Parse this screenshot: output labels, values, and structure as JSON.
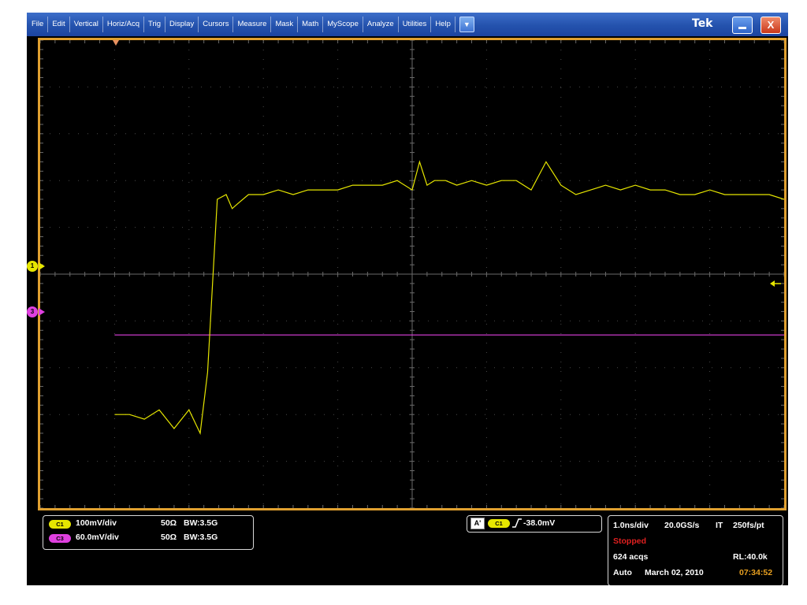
{
  "menu": {
    "items": [
      "File",
      "Edit",
      "Vertical",
      "Horiz/Acq",
      "Trig",
      "Display",
      "Cursors",
      "Measure",
      "Mask",
      "Math",
      "MyScope",
      "Analyze",
      "Utilities",
      "Help"
    ],
    "more_icon": "dropdown-arrow-icon"
  },
  "window": {
    "logo": "Tek",
    "minimize_icon": "minimize-icon",
    "close_label": "X"
  },
  "markers": {
    "ch1": "1",
    "ch3": "3"
  },
  "channels": [
    {
      "chip": "C1",
      "scale": "100mV/div",
      "impedance": "50Ω",
      "bw_label": "BW",
      "bandwidth": ":3.5G",
      "color": "#e6e600"
    },
    {
      "chip": "C3",
      "scale": "60.0mV/div",
      "impedance": "50Ω",
      "bw_label": "BW",
      "bandwidth": ":3.5G",
      "color": "#e040e0"
    }
  ],
  "trigger": {
    "mode_label": "A'",
    "source": "C1",
    "slope_icon": "rising-edge-icon",
    "level": "-38.0mV"
  },
  "acquisition": {
    "time_div": "1.0ns/div",
    "sample_rate": "20.0GS/s",
    "mode": "IT",
    "resolution": "250fs/pt",
    "state": "Stopped",
    "acqs": "624 acqs",
    "record_length": "RL:40.0k",
    "trigger_mode": "Auto",
    "date": "March 02, 2010",
    "time": "07:34:52"
  },
  "chart_data": {
    "type": "line",
    "x": [
      -4.0,
      -3.8,
      -3.6,
      -3.4,
      -3.2,
      -3.0,
      -2.85,
      -2.75,
      -2.62,
      -2.5,
      -2.42,
      -2.35,
      -2.2,
      -2.0,
      -1.8,
      -1.6,
      -1.4,
      -1.2,
      -1.0,
      -0.8,
      -0.6,
      -0.4,
      -0.2,
      0.0,
      0.1,
      0.2,
      0.3,
      0.45,
      0.6,
      0.8,
      1.0,
      1.2,
      1.4,
      1.6,
      1.8,
      2.0,
      2.2,
      2.4,
      2.6,
      2.8,
      3.0,
      3.2,
      3.4,
      3.6,
      3.8,
      4.0,
      4.2,
      4.4,
      4.6,
      4.8,
      5.0
    ],
    "series": [
      {
        "values": [
          -3.0,
          -3.0,
          -3.1,
          -2.9,
          -3.3,
          -2.9,
          -3.4,
          -2.1,
          1.6,
          1.7,
          1.4,
          1.5,
          1.7,
          1.7,
          1.8,
          1.7,
          1.8,
          1.8,
          1.8,
          1.9,
          1.9,
          1.9,
          2.0,
          1.8,
          2.4,
          1.9,
          2.0,
          2.0,
          1.9,
          2.0,
          1.9,
          2.0,
          2.0,
          1.8,
          2.4,
          1.9,
          1.7,
          1.8,
          1.9,
          1.8,
          1.9,
          1.8,
          1.8,
          1.7,
          1.7,
          1.8,
          1.7,
          1.7,
          1.7,
          1.7,
          1.6
        ]
      },
      {
        "values": [
          -1.3,
          -1.3,
          -1.3,
          -1.3,
          -1.3,
          -1.3,
          -1.3,
          -1.3,
          -1.3,
          -1.3,
          -1.3,
          -1.3,
          -1.3,
          -1.3,
          -1.3,
          -1.3,
          -1.3,
          -1.3,
          -1.3,
          -1.3,
          -1.3,
          -1.3,
          -1.3,
          -1.3,
          -1.3,
          -1.3,
          -1.3,
          -1.3,
          -1.3,
          -1.3,
          -1.3,
          -1.3,
          -1.3,
          -1.3,
          -1.3,
          -1.3,
          -1.3,
          -1.3,
          -1.3,
          -1.3,
          -1.3,
          -1.3,
          -1.3,
          -1.3,
          -1.3,
          -1.3,
          -1.3,
          -1.3,
          -1.3,
          -1.3,
          -1.3
        ]
      }
    ],
    "xlim": [
      -5,
      5
    ],
    "ylim": [
      -5,
      5
    ],
    "grid": true,
    "colors": [
      "#e6e600",
      "#e040e0"
    ]
  }
}
